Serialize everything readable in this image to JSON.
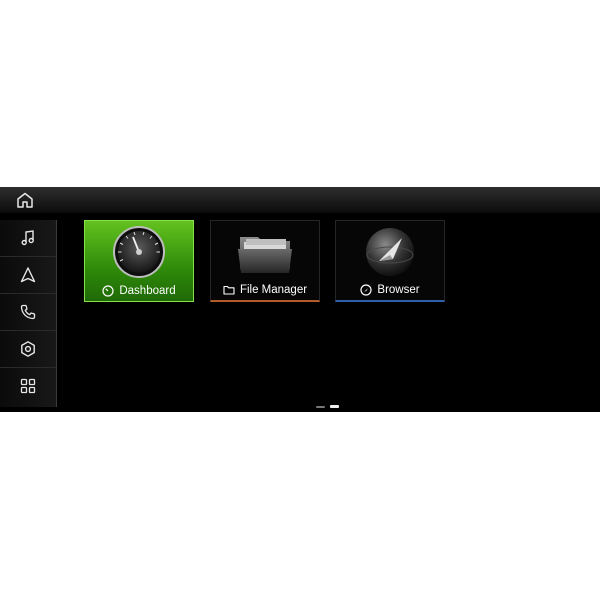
{
  "colors": {
    "screen_bg": "#000000",
    "dashboard_accent": "#4faf1a",
    "file_manager_accent": "#b35a2b",
    "browser_accent": "#2f5fa8"
  },
  "topbar": {
    "home_icon": "home-icon"
  },
  "sidebar": {
    "items": [
      {
        "name": "music",
        "icon": "music-note-icon"
      },
      {
        "name": "navigation",
        "icon": "navigation-arrow-icon"
      },
      {
        "name": "phone",
        "icon": "phone-icon"
      },
      {
        "name": "settings",
        "icon": "settings-hexagon-icon"
      },
      {
        "name": "apps",
        "icon": "apps-grid-icon"
      }
    ]
  },
  "apps": [
    {
      "label": "Dashboard",
      "icon": "speedometer-icon",
      "selected": true
    },
    {
      "label": "File Manager",
      "icon": "folder-icon",
      "selected": false
    },
    {
      "label": "Browser",
      "icon": "compass-icon",
      "selected": false
    }
  ],
  "pager": {
    "pages": 2,
    "current_page": 2
  }
}
